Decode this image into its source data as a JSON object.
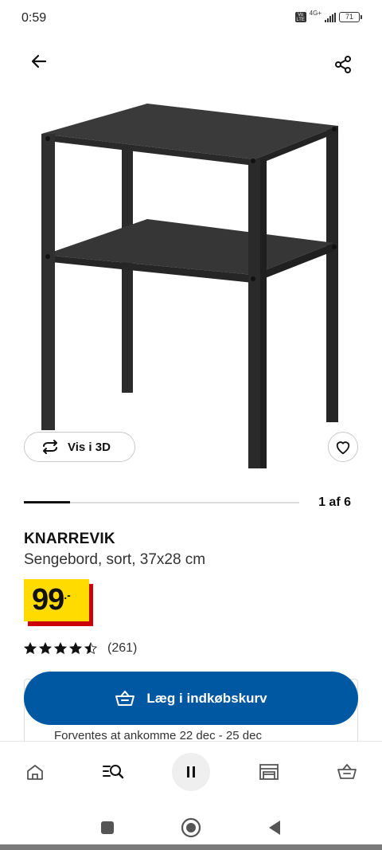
{
  "status_bar": {
    "time": "0:59",
    "volte": "Vo LTE",
    "network": "4G+",
    "battery": "71"
  },
  "header": {
    "back_icon": "arrow-left-icon",
    "share_icon": "share-icon"
  },
  "gallery": {
    "view_3d_label": "Vis i 3D",
    "counter": "1 af 6",
    "progress": 0.167
  },
  "product": {
    "name": "KNARREVIK",
    "description": "Sengebord, sort, 37x28 cm",
    "price_main": "99",
    "price_suffix": ".-",
    "rating_value": 4.5,
    "rating_count": "(261)"
  },
  "cart": {
    "add_label": "Læg i indkøbskurv"
  },
  "delivery": {
    "text": "Forventes at ankomme 22 dec - 25 dec"
  },
  "bottom_nav": {
    "items": [
      "home-icon",
      "search-icon",
      "pause-icon",
      "store-icon",
      "basket-icon"
    ]
  },
  "colors": {
    "brand_blue": "#0058a3",
    "price_yellow": "#ffdb00",
    "price_red": "#cc0008"
  }
}
